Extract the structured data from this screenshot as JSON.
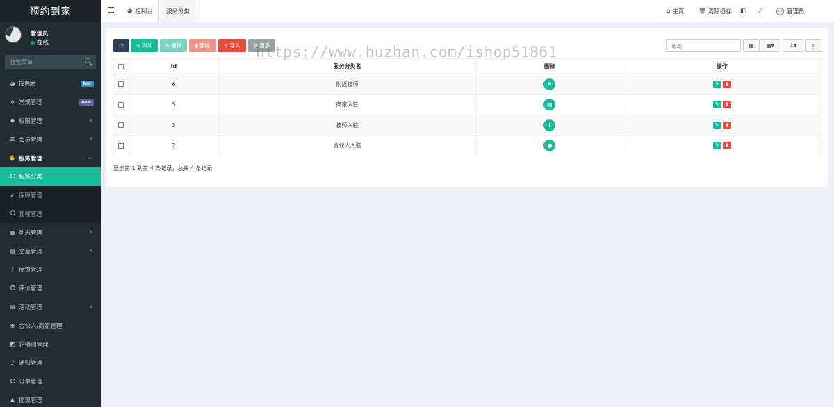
{
  "app": {
    "title": "预约到家"
  },
  "user": {
    "name": "管理员",
    "status": "在线"
  },
  "sidebar": {
    "search_placeholder": "搜索菜单",
    "items": [
      {
        "label": "控制台",
        "icon": "dashboard-icon",
        "badge": "hot",
        "badge_color": "#3c8dbc"
      },
      {
        "label": "常规管理",
        "icon": "cogs-icon",
        "badge": "new",
        "badge_color": "#605ca8"
      },
      {
        "label": "权限管理",
        "icon": "group-icon",
        "chevron": "‹"
      },
      {
        "label": "会员管理",
        "icon": "list-icon",
        "chevron": "‹"
      },
      {
        "label": "服务管理",
        "icon": "hand-icon",
        "chevron": "⌄",
        "open": true
      },
      {
        "label": "服务分类",
        "icon": "circle-icon",
        "active": true
      },
      {
        "label": "保障管理",
        "icon": "check-icon",
        "sub": true
      },
      {
        "label": "套餐管理",
        "icon": "circle-icon",
        "sub": true
      },
      {
        "label": "动态管理",
        "icon": "calendar-icon",
        "chevron": "‹"
      },
      {
        "label": "文章管理",
        "icon": "file-icon",
        "chevron": "‹"
      },
      {
        "label": "反馈管理",
        "icon": "feedback-icon"
      },
      {
        "label": "评价管理",
        "icon": "circle-icon"
      },
      {
        "label": "活动管理",
        "icon": "file-icon",
        "chevron": "‹"
      },
      {
        "label": "合伙人/商家管理",
        "icon": "eye-icon"
      },
      {
        "label": "轮播图管理",
        "icon": "image-icon"
      },
      {
        "label": "通知管理",
        "icon": "bell-icon"
      },
      {
        "label": "订单管理",
        "icon": "circle-icon"
      },
      {
        "label": "提现管理",
        "icon": "caret-up-icon"
      }
    ]
  },
  "header": {
    "tabs": [
      {
        "label": "控制台",
        "icon": "dashboard-icon"
      },
      {
        "label": "服务分类",
        "active": true
      }
    ],
    "home": "主页",
    "clear_cache": "清除缓存",
    "admin": "管理员"
  },
  "toolbar": {
    "refresh": "",
    "add": "添加",
    "edit": "编辑",
    "delete": "删除",
    "import": "导入",
    "more": "更多",
    "search_placeholder": "搜索",
    "colors": {
      "refresh": "#2c3e50",
      "add": "#18bc9c",
      "edit": "#79d5c2",
      "delete": "#f0958a",
      "import": "#e74c3c",
      "more": "#95a5a6"
    }
  },
  "watermark": "https://www.huzhan.com/ishop51861",
  "table": {
    "columns": [
      "Id",
      "服务分类名",
      "图标",
      "操作"
    ],
    "rows": [
      {
        "id": "6",
        "name": "附近技师",
        "icon": "flag-icon"
      },
      {
        "id": "5",
        "name": "商家入驻",
        "icon": "store-icon"
      },
      {
        "id": "3",
        "name": "技师入驻",
        "icon": "download-icon"
      },
      {
        "id": "2",
        "name": "合伙人入驻",
        "icon": "trophy-icon"
      }
    ]
  },
  "pagination_text": "显示第 1 到第 4 条记录，总共 4 条记录"
}
